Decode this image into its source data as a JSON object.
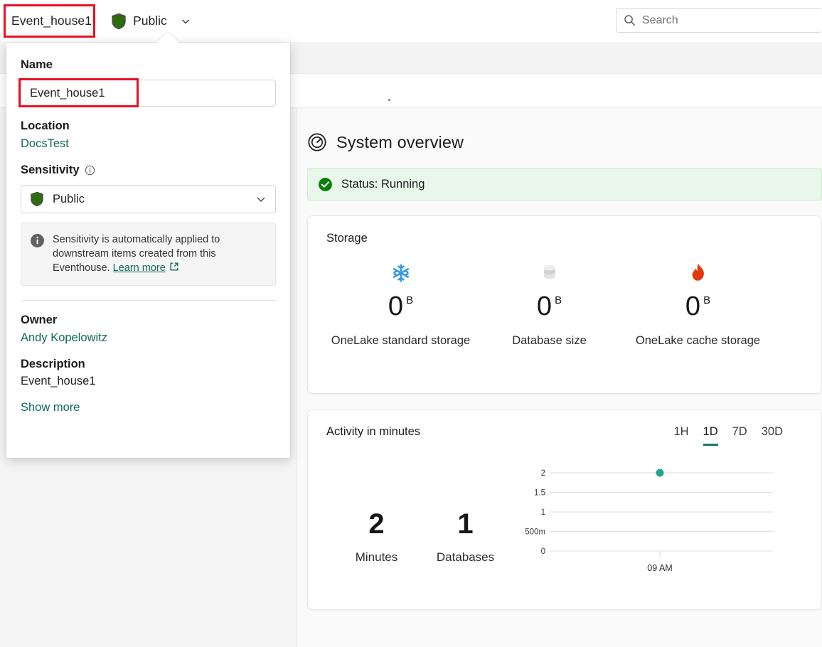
{
  "topbar": {
    "item_name": "Event_house1",
    "sensitivity_label": "Public",
    "shield_icon": "shield-icon",
    "chevron_icon": "chevron-down-icon",
    "search": {
      "placeholder": "Search",
      "value": "",
      "icon": "search-icon"
    }
  },
  "flyout": {
    "name_label": "Name",
    "name_value": "Event_house1",
    "location_label": "Location",
    "location_value": "DocsTest",
    "sensitivity_label": "Sensitivity",
    "sensitivity_info_icon": "info-icon",
    "sensitivity_value": "Public",
    "sensitivity_shield_icon": "shield-icon",
    "sensitivity_chevron_icon": "chevron-down-icon",
    "info_icon": "info-circle-icon",
    "info_text_part1": "Sensitivity is automatically applied to downstream items created from this Eventhouse.",
    "info_link": "Learn more",
    "info_link_icon": "external-link-icon",
    "owner_label": "Owner",
    "owner_value": "Andy Kopelowitz",
    "description_label": "Description",
    "description_value": "Event_house1",
    "show_more": "Show more"
  },
  "main": {
    "system_overview_title": "System overview",
    "system_overview_icon": "gauge-icon",
    "status": {
      "text": "Status: Running",
      "icon": "check-circle-icon",
      "color": "#107c10"
    },
    "storage": {
      "title": "Storage",
      "metrics": [
        {
          "icon": "snowflake-icon",
          "icon_color": "#3399e6",
          "value": "0",
          "unit": "B",
          "label": "OneLake standard storage"
        },
        {
          "icon": "database-icon",
          "icon_color": "#d6d6d6",
          "value": "0",
          "unit": "B",
          "label": "Database size"
        },
        {
          "icon": "flame-icon",
          "icon_color": "#e03b10",
          "value": "0",
          "unit": "B",
          "label": "OneLake cache storage"
        }
      ]
    },
    "activity": {
      "title": "Activity in minutes",
      "ranges": [
        "1H",
        "1D",
        "7D",
        "30D"
      ],
      "active_range": "1D",
      "stats": [
        {
          "value": "2",
          "label": "Minutes"
        },
        {
          "value": "1",
          "label": "Databases"
        }
      ]
    }
  },
  "chart_data": {
    "type": "scatter",
    "title": "Activity in minutes",
    "xlabel": "",
    "ylabel": "",
    "x": [
      "09 AM"
    ],
    "values": [
      2
    ],
    "series": [
      {
        "name": "Minutes",
        "values": [
          2
        ],
        "color": "#2aa392"
      }
    ],
    "ytick_labels": [
      "0",
      "500m",
      "1",
      "1.5",
      "2"
    ],
    "ytick_values": [
      0,
      0.5,
      1,
      1.5,
      2
    ],
    "ylim": [
      0,
      2
    ],
    "xtick_labels": [
      "09 AM"
    ],
    "grid": true,
    "legend": "none"
  },
  "annotations": {
    "accent_color": "#e81123",
    "boxes": [
      "item-name-title",
      "name-input-field"
    ]
  }
}
